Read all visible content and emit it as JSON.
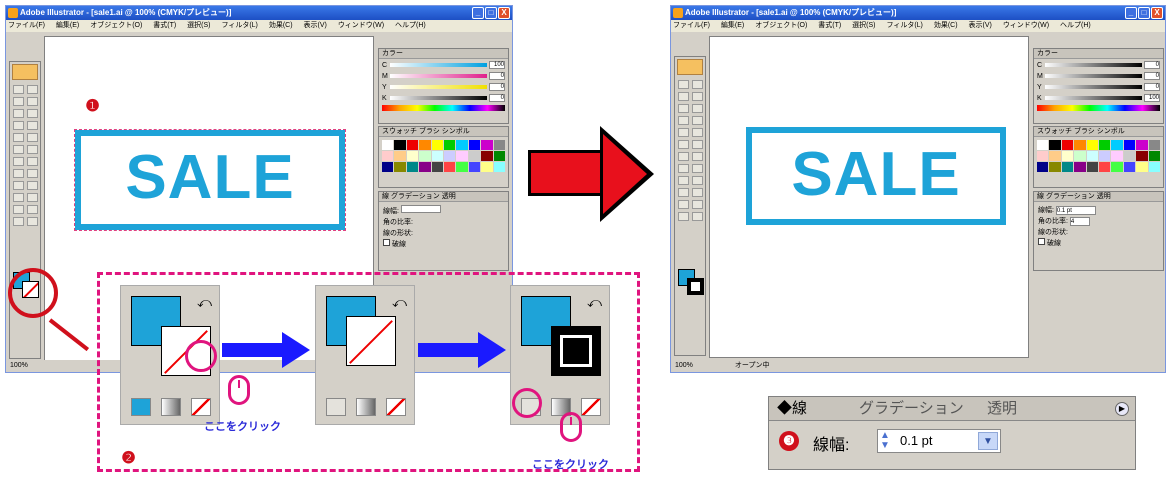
{
  "window": {
    "title": "Adobe Illustrator - [sale1.ai @ 100% (CMYK/プレビュー)]",
    "minimize": "_",
    "maximize": "□",
    "close": "X"
  },
  "menu": [
    "ファイル(F)",
    "編集(E)",
    "オブジェクト(O)",
    "書式(T)",
    "選択(S)",
    "フィルタ(L)",
    "効果(C)",
    "表示(V)",
    "ウィンドウ(W)",
    "ヘルプ(H)"
  ],
  "color_panel": {
    "tab": "カラー",
    "before": [
      {
        "label": "C",
        "value": "100"
      },
      {
        "label": "M",
        "value": "0"
      },
      {
        "label": "Y",
        "value": "0"
      },
      {
        "label": "K",
        "value": "0"
      }
    ],
    "after": [
      {
        "label": "C",
        "value": "0"
      },
      {
        "label": "M",
        "value": "0"
      },
      {
        "label": "Y",
        "value": "0"
      },
      {
        "label": "K",
        "value": "100"
      }
    ]
  },
  "swatch_panel": {
    "tabs": "スウォッチ ブラシ シンボル"
  },
  "stroke_panel_small": {
    "tabs": "線 グラデーション 透明",
    "weight_label": "線幅:",
    "cap_label": "角の比率:",
    "dash_label": "線の形状:",
    "dash_checkbox": "破線",
    "after_weight": "0.1 pt",
    "after_ratio": "4"
  },
  "canvas": {
    "sale_text": "SALE",
    "status_zoom": "100%",
    "status_label": "オープン中"
  },
  "annotations": {
    "step1": "❶",
    "step2": "❷",
    "step3": "❸",
    "click_here_1": "ここをクリック",
    "click_here_2": "ここをクリック"
  },
  "stroke_panel_zoom": {
    "tab_stroke": "線",
    "tab_gradient": "グラデーション",
    "tab_transparency": "透明",
    "weight_label": "線幅:",
    "weight_value": "0.1 pt"
  },
  "colors": {
    "accent_cyan": "#1ea3d8",
    "annotation_red": "#d0101c",
    "annotation_pink": "#e0147e",
    "arrow_blue": "#1a1aff",
    "title_blue": "#1d4fc4"
  }
}
